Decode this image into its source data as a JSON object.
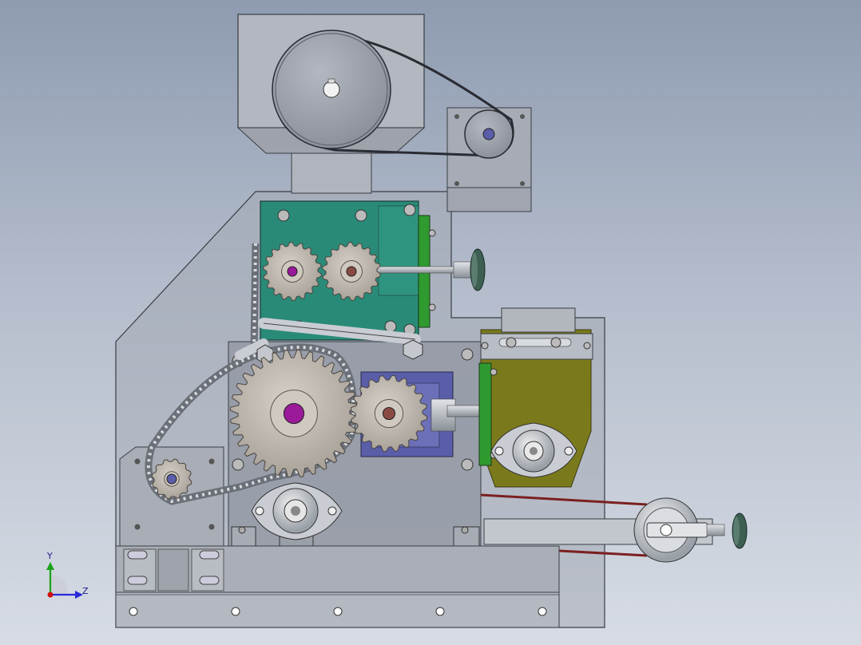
{
  "view": {
    "background_top": "#8e9bb0",
    "background_bottom": "#d7dce4"
  },
  "triad": {
    "y_label": "Y",
    "z_label": "Z",
    "y_color": "#1aa31a",
    "z_color": "#2a2adb",
    "x_color": "#d01010"
  },
  "colors": {
    "housing": "#a9aeb8",
    "frame": "#8c919a",
    "teal_plate": "#2a8a78",
    "green_bracket": "#2f9a2f",
    "olive_block": "#7a7a1c",
    "purple_block": "#5a5ea8",
    "gear": "#bfb8ae",
    "hub_purple": "#9a1a9a",
    "hub_brown": "#8a4a42",
    "belt": "#7a2020",
    "knob": "#3c5f52"
  }
}
